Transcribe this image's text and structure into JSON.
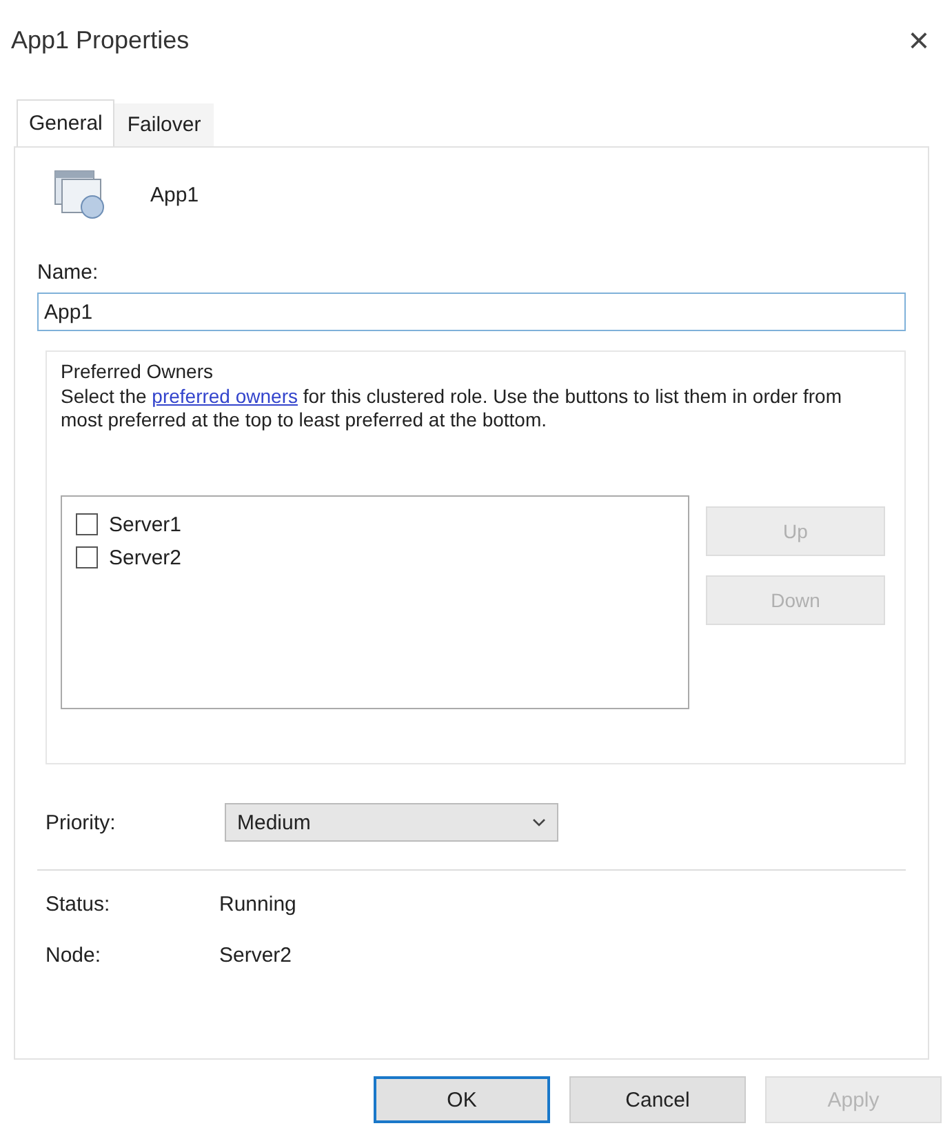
{
  "window": {
    "title": "App1 Properties",
    "close": "×"
  },
  "tabs": [
    {
      "label": "General",
      "selected": true
    },
    {
      "label": "Failover",
      "selected": false
    }
  ],
  "role": {
    "name": "App1"
  },
  "name_field": {
    "label": "Name:",
    "value": "App1"
  },
  "preferred_owners": {
    "title": "Preferred Owners",
    "description_before": "Select the ",
    "link": "preferred owners",
    "description_after": " for this clustered role. Use the buttons to list them in order from most preferred at the top to least preferred at the bottom.",
    "servers": [
      {
        "label": "Server1",
        "checked": false
      },
      {
        "label": "Server2",
        "checked": false
      }
    ],
    "buttons": [
      {
        "label": "Up",
        "disabled": true
      },
      {
        "label": "Down",
        "disabled": true
      }
    ]
  },
  "priority": {
    "label": "Priority:",
    "value": "Medium"
  },
  "info": [
    {
      "label": "Status:",
      "value": "Running"
    },
    {
      "label": "Node:",
      "value": "Server2"
    }
  ],
  "buttons": [
    {
      "label": "OK",
      "default": true,
      "disabled": false
    },
    {
      "label": "Cancel",
      "default": false,
      "disabled": false
    },
    {
      "label": "Apply",
      "default": false,
      "disabled": true
    }
  ]
}
